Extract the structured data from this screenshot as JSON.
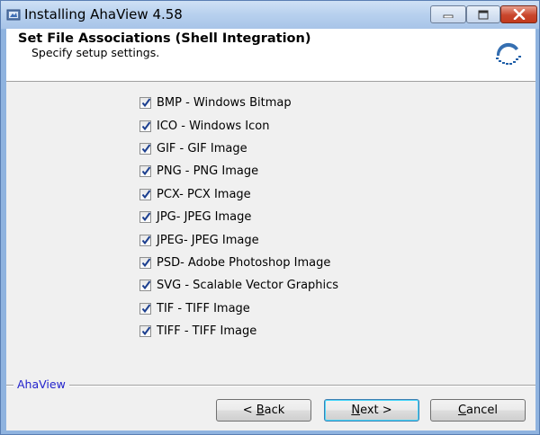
{
  "window": {
    "title": "Installing AhaView 4.58"
  },
  "header": {
    "title": "Set File Associations (Shell Integration)",
    "subtitle": "Specify setup settings."
  },
  "file_types": [
    {
      "label": "BMP - Windows Bitmap",
      "checked": true
    },
    {
      "label": "ICO - Windows Icon",
      "checked": true
    },
    {
      "label": "GIF - GIF Image",
      "checked": true
    },
    {
      "label": "PNG - PNG Image",
      "checked": true
    },
    {
      "label": "PCX- PCX Image",
      "checked": true
    },
    {
      "label": "JPG- JPEG Image",
      "checked": true
    },
    {
      "label": "JPEG- JPEG Image",
      "checked": true
    },
    {
      "label": "PSD- Adobe Photoshop Image",
      "checked": true
    },
    {
      "label": "SVG - Scalable Vector Graphics",
      "checked": true
    },
    {
      "label": "TIF - TIFF Image",
      "checked": true
    },
    {
      "label": "TIFF - TIFF Image",
      "checked": true
    }
  ],
  "footer": {
    "brand": "AhaView",
    "back_prefix": "< ",
    "back_key": "B",
    "back_rest": "ack",
    "next_key": "N",
    "next_rest": "ext >",
    "cancel_key": "C",
    "cancel_rest": "ancel"
  },
  "colors": {
    "brand_text": "#2222cc",
    "check_mark": "#1c3f8f",
    "close_button": "#c9462c"
  },
  "icons": [
    "installer-app-icon",
    "minimize-icon",
    "maximize-icon",
    "close-icon",
    "ahaview-logo-icon",
    "checkmark-icon"
  ]
}
